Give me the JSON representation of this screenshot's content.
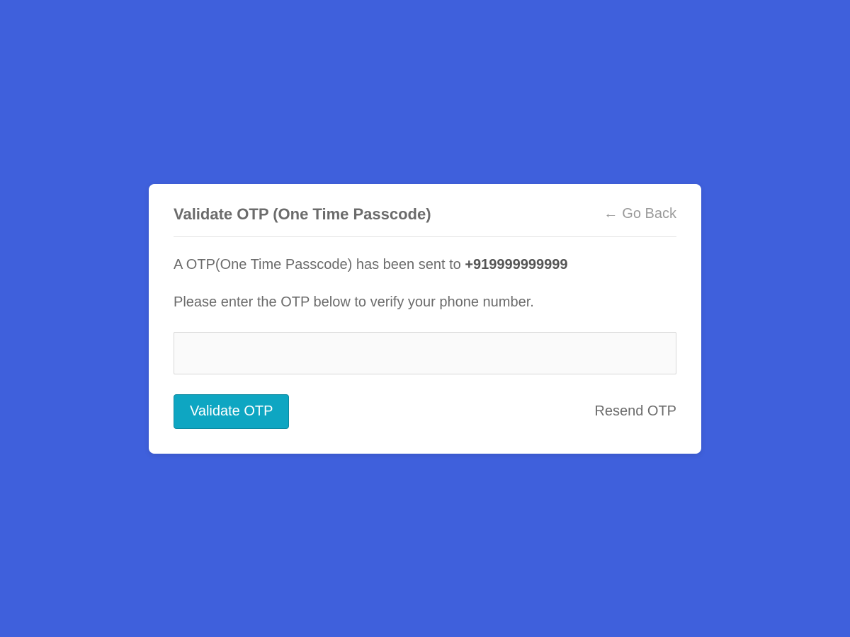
{
  "header": {
    "title": "Validate OTP (One Time Passcode)",
    "go_back_label": "Go Back"
  },
  "body": {
    "sent_prefix": "A OTP(One Time Passcode) has been sent to ",
    "phone_number": "+919999999999",
    "instruction": "Please enter the OTP below to verify your phone number.",
    "otp_value": ""
  },
  "footer": {
    "validate_label": "Validate OTP",
    "resend_label": "Resend OTP"
  }
}
